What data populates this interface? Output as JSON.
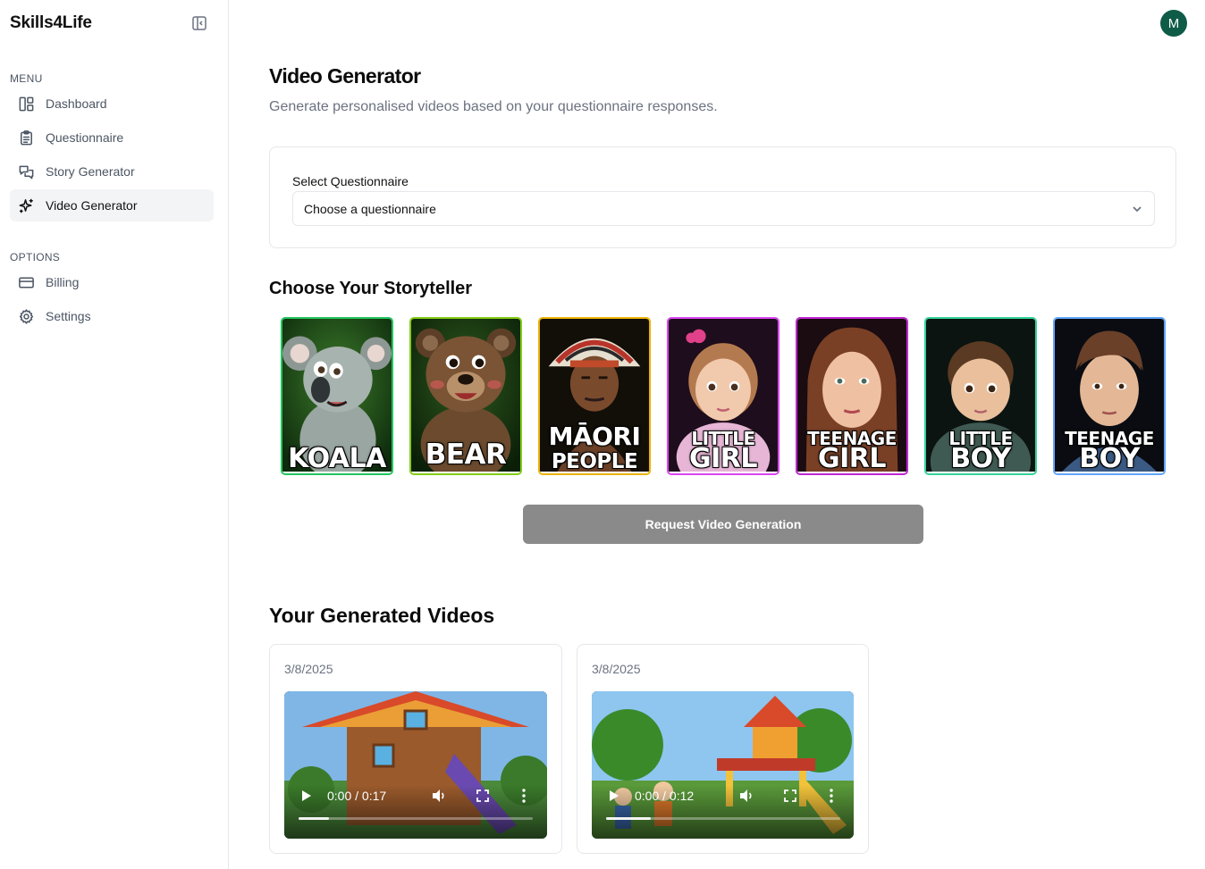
{
  "brand": "Skills4Life",
  "sidebar": {
    "menu_label": "MENU",
    "options_label": "OPTIONS",
    "menu_items": [
      {
        "label": "Dashboard",
        "icon": "dashboard-icon"
      },
      {
        "label": "Questionnaire",
        "icon": "clipboard-icon"
      },
      {
        "label": "Story Generator",
        "icon": "chat-icon"
      },
      {
        "label": "Video Generator",
        "icon": "sparkles-icon",
        "active": true
      }
    ],
    "option_items": [
      {
        "label": "Billing",
        "icon": "credit-card-icon"
      },
      {
        "label": "Settings",
        "icon": "gear-icon"
      }
    ]
  },
  "user": {
    "avatar_initial": "M",
    "avatar_color": "#0e5c47"
  },
  "main": {
    "title": "Video Generator",
    "subtitle": "Generate personalised videos based on your questionnaire responses.",
    "select": {
      "label": "Select Questionnaire",
      "value": "Choose a questionnaire"
    },
    "storyteller_heading": "Choose Your Storyteller",
    "storytellers": [
      {
        "line1": "KOALA",
        "line2": "",
        "border": "#22c55e"
      },
      {
        "line1": "BEAR",
        "line2": "",
        "border": "#84cc16"
      },
      {
        "line1": "MĀORI",
        "line2": "PEOPLE",
        "border": "#eab308"
      },
      {
        "line1": "LITTLE",
        "line2": "GIRL",
        "border": "#d946ef"
      },
      {
        "line1": "TEENAGE",
        "line2": "GIRL",
        "border": "#c026d3"
      },
      {
        "line1": "LITTLE",
        "line2": "BOY",
        "border": "#34d399"
      },
      {
        "line1": "TEENAGE",
        "line2": "BOY",
        "border": "#60a5fa"
      }
    ],
    "request_button": "Request Video Generation",
    "videos_heading": "Your Generated Videos",
    "videos": [
      {
        "date": "3/8/2025",
        "time": "0:00 / 0:17",
        "progress": 0.13
      },
      {
        "date": "3/8/2025",
        "time": "0:00 / 0:12",
        "progress": 0.19
      }
    ]
  }
}
